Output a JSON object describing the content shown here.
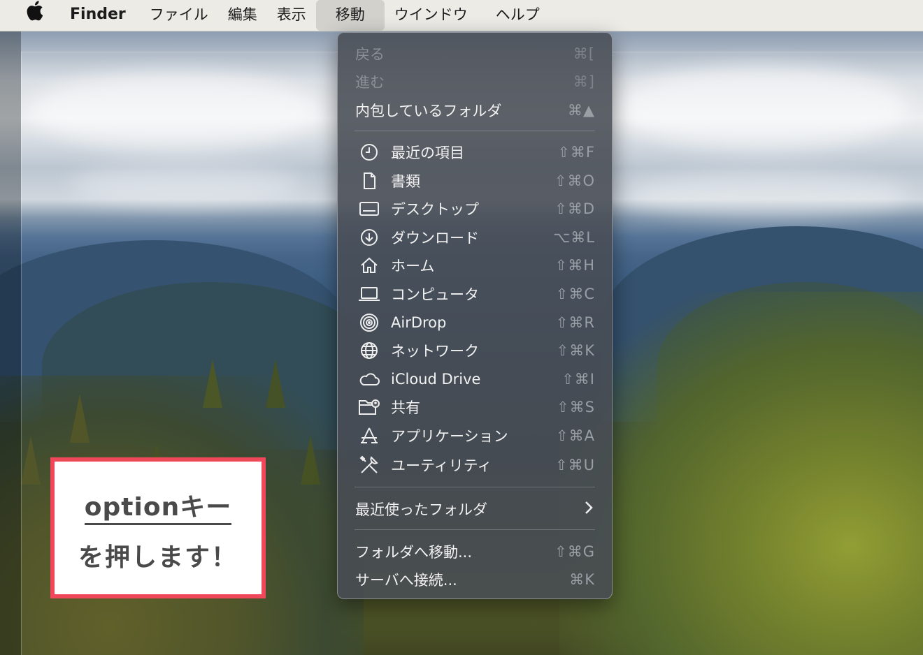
{
  "menubar": {
    "apple_icon": "apple-logo-icon",
    "app_name": "Finder",
    "items": [
      "ファイル",
      "編集",
      "表示",
      "移動",
      "ウインドウ",
      "ヘルプ"
    ],
    "active_item": "移動",
    "background": "#ecebe6"
  },
  "go_menu": {
    "items": [
      {
        "label": "戻る",
        "shortcut": "⌘[",
        "enabled": false
      },
      {
        "label": "進む",
        "shortcut": "⌘]",
        "enabled": false
      },
      {
        "label": "内包しているフォルダ",
        "shortcut": "⌘▲",
        "enabled": true
      },
      {
        "label": "最近の項目",
        "shortcut": "⇧⌘F",
        "icon": "clock-icon"
      },
      {
        "label": "書類",
        "shortcut": "⇧⌘O",
        "icon": "document-icon"
      },
      {
        "label": "デスクトップ",
        "shortcut": "⇧⌘D",
        "icon": "desktop-icon"
      },
      {
        "label": "ダウンロード",
        "shortcut": "⌥⌘L",
        "icon": "download-icon"
      },
      {
        "label": "ホーム",
        "shortcut": "⇧⌘H",
        "icon": "home-icon"
      },
      {
        "label": "コンピュータ",
        "shortcut": "⇧⌘C",
        "icon": "laptop-icon"
      },
      {
        "label": "AirDrop",
        "shortcut": "⇧⌘R",
        "icon": "airdrop-icon"
      },
      {
        "label": "ネットワーク",
        "shortcut": "⇧⌘K",
        "icon": "globe-icon"
      },
      {
        "label": "iCloud Drive",
        "shortcut": "⇧⌘I",
        "icon": "cloud-icon"
      },
      {
        "label": "共有",
        "shortcut": "⇧⌘S",
        "icon": "shared-folder-icon"
      },
      {
        "label": "アプリケーション",
        "shortcut": "⇧⌘A",
        "icon": "applications-icon"
      },
      {
        "label": "ユーティリティ",
        "shortcut": "⇧⌘U",
        "icon": "utilities-icon"
      },
      {
        "label": "最近使ったフォルダ",
        "submenu": true
      },
      {
        "label": "フォルダへ移動...",
        "shortcut": "⇧⌘G"
      },
      {
        "label": "サーバへ接続...",
        "shortcut": "⌘K"
      }
    ]
  },
  "callout": {
    "line1": "optionキー",
    "line2": "を押します！",
    "border_color": "#f0475a"
  }
}
